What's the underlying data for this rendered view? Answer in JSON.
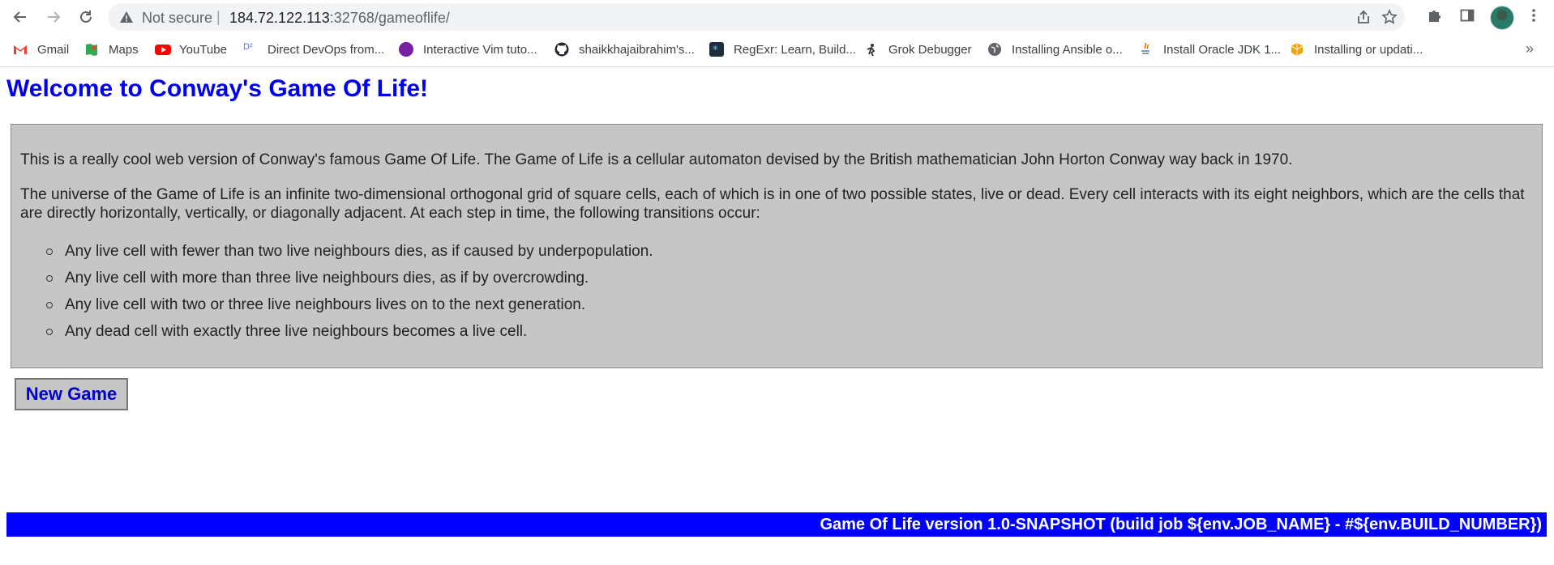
{
  "browser": {
    "address_bar": {
      "security_label": "Not secure",
      "url_host": "184.72.122.113",
      "url_rest": ":32768/gameoflife/"
    },
    "bookmarks": [
      {
        "label": "Gmail",
        "icon": "gmail-icon",
        "color": "#ea4335"
      },
      {
        "label": "Maps",
        "icon": "maps-icon",
        "color": "#34a853"
      },
      {
        "label": "YouTube",
        "icon": "youtube-icon",
        "color": "#ff0000"
      },
      {
        "label": "Direct DevOps from...",
        "icon": "devops-icon",
        "color": "#4b7bec"
      },
      {
        "label": "Interactive Vim tuto...",
        "icon": "vim-icon",
        "color": "#7b1fa2"
      },
      {
        "label": "shaikkhajaibrahim's...",
        "icon": "github-icon",
        "color": "#24292e"
      },
      {
        "label": "RegExr: Learn, Build...",
        "icon": "regexr-icon",
        "color": "#1f2d3d"
      },
      {
        "label": "Grok Debugger",
        "icon": "grok-icon",
        "color": "#333333"
      },
      {
        "label": "Installing Ansible o...",
        "icon": "globe-icon",
        "color": "#5f6368"
      },
      {
        "label": "Install Oracle JDK 1...",
        "icon": "java-icon",
        "color": "#e76f00"
      },
      {
        "label": "Installing or updati...",
        "icon": "aws-icon",
        "color": "#f0a30a"
      }
    ],
    "more_bookmarks": "»"
  },
  "page": {
    "title": "Welcome to Conway's Game Of Life!",
    "intro": "This is a really cool web version of Conway's famous Game Of Life. The Game of Life is a cellular automaton devised by the British mathematician John Horton Conway way back in 1970.",
    "universe": "The universe of the Game of Life is an infinite two-dimensional orthogonal grid of square cells, each of which is in one of two possible states, live or dead. Every cell interacts with its eight neighbors, which are the cells that are directly horizontally, vertically, or diagonally adjacent. At each step in time, the following transitions occur:",
    "rules": [
      "Any live cell with fewer than two live neighbours dies, as if caused by underpopulation.",
      "Any live cell with more than three live neighbours dies, as if by overcrowding.",
      "Any live cell with two or three live neighbours lives on to the next generation.",
      "Any dead cell with exactly three live neighbours becomes a live cell."
    ],
    "new_game_label": "New Game",
    "footer": "Game Of Life version 1.0-SNAPSHOT (build job ${env.JOB_NAME} - #${env.BUILD_NUMBER})"
  },
  "colors": {
    "title": "#0000ee",
    "panel_background": "#c6c6c6",
    "footer_background": "#0000ff"
  }
}
